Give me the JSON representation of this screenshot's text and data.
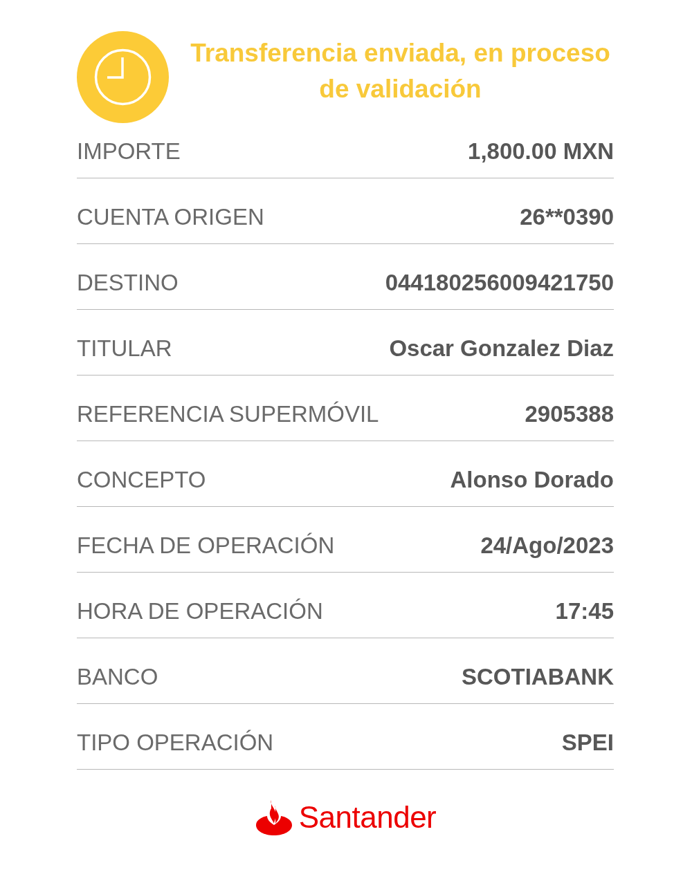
{
  "status": {
    "title": "Transferencia enviada, en proceso de validación"
  },
  "details": [
    {
      "label": "IMPORTE",
      "value": "1,800.00 MXN"
    },
    {
      "label": "CUENTA ORIGEN",
      "value": "26**0390"
    },
    {
      "label": "DESTINO",
      "value": "044180256009421750"
    },
    {
      "label": "TITULAR",
      "value": "Oscar Gonzalez Diaz"
    },
    {
      "label": "REFERENCIA SUPERMÓVIL",
      "value": "2905388"
    },
    {
      "label": "CONCEPTO",
      "value": "Alonso Dorado"
    },
    {
      "label": "FECHA DE OPERACIÓN",
      "value": "24/Ago/2023"
    },
    {
      "label": "HORA DE OPERACIÓN",
      "value": "17:45"
    },
    {
      "label": "BANCO",
      "value": "SCOTIABANK"
    },
    {
      "label": "TIPO OPERACIÓN",
      "value": "SPEI"
    }
  ],
  "brand": {
    "name": "Santander"
  }
}
